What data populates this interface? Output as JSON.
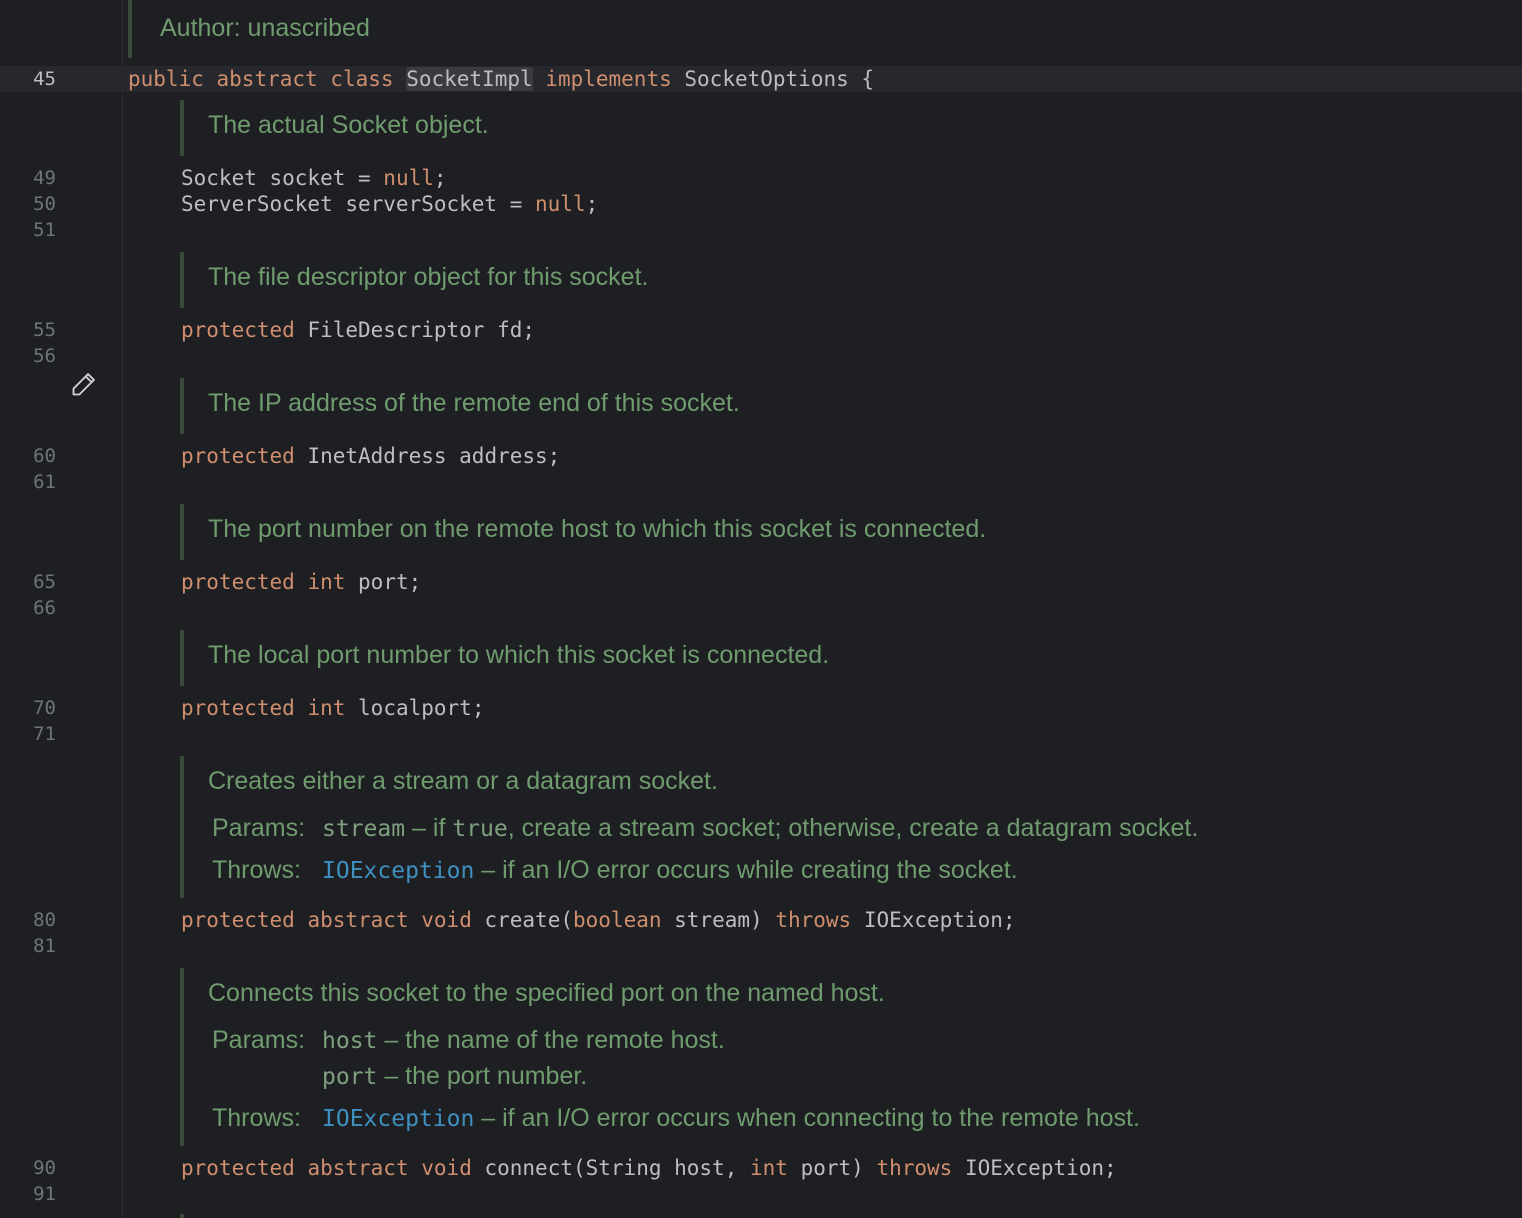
{
  "line_numbers": {
    "current": "45",
    "others": [
      "49",
      "50",
      "51",
      "55",
      "56",
      "60",
      "61",
      "65",
      "66",
      "70",
      "71",
      "80",
      "81",
      "90",
      "91"
    ]
  },
  "doc_author": "Author: unascribed",
  "class_decl": {
    "kw1": "public",
    "kw2": "abstract",
    "kw3": "class",
    "name": "SocketImpl",
    "kw4": "implements",
    "iface": "SocketOptions",
    "brace": "{"
  },
  "docs": {
    "socket": "The actual Socket object.",
    "fd": "The file descriptor object for this socket.",
    "address": "The IP address of the remote end of this socket.",
    "port": "The port number on the remote host to which this socket is connected.",
    "localport": "The local port number to which this socket is connected.",
    "create": {
      "summary": "Creates either a stream or a datagram socket.",
      "params_label": "Params:",
      "param_name": "stream",
      "param_dash": " – if ",
      "param_true": "true",
      "param_rest": ", create a stream socket; otherwise, create a datagram socket.",
      "throws_label": "Throws:",
      "throws_type": "IOException",
      "throws_text": " – if an I/O error occurs while creating the socket."
    },
    "connect": {
      "summary": "Connects this socket to the specified port on the named host.",
      "params_label": "Params:",
      "param1_name": "host",
      "param1_text": " – the name of the remote host.",
      "param2_name": "port",
      "param2_text": " – the port number.",
      "throws_label": "Throws:",
      "throws_type": "IOException",
      "throws_text": " – if an I/O error occurs when connecting to the remote host."
    }
  },
  "code": {
    "l49": {
      "type": "Socket",
      "name": " socket = ",
      "val": "null",
      "end": ";"
    },
    "l50": {
      "type": "ServerSocket",
      "name": " serverSocket = ",
      "val": "null",
      "end": ";"
    },
    "l55": {
      "kw": "protected",
      "rest": " FileDescriptor fd;"
    },
    "l60": {
      "kw": "protected",
      "rest": " InetAddress address;"
    },
    "l65": {
      "kw": "protected",
      "kw2": "int",
      "rest": " port;"
    },
    "l70": {
      "kw": "protected",
      "kw2": "int",
      "rest": " localport;"
    },
    "l80": {
      "kw": "protected",
      "kw2": "abstract",
      "kw3": "void",
      "mid": " create(",
      "kw4": "boolean",
      "mid2": " stream) ",
      "kw5": "throws",
      "end": " IOException;"
    },
    "l90": {
      "kw": "protected",
      "kw2": "abstract",
      "kw3": "void",
      "mid": " connect(String host, ",
      "kw4": "int",
      "mid2": " port) ",
      "kw5": "throws",
      "end": " IOException;"
    }
  },
  "icons": {
    "gutter_edit": "pencil-icon"
  }
}
